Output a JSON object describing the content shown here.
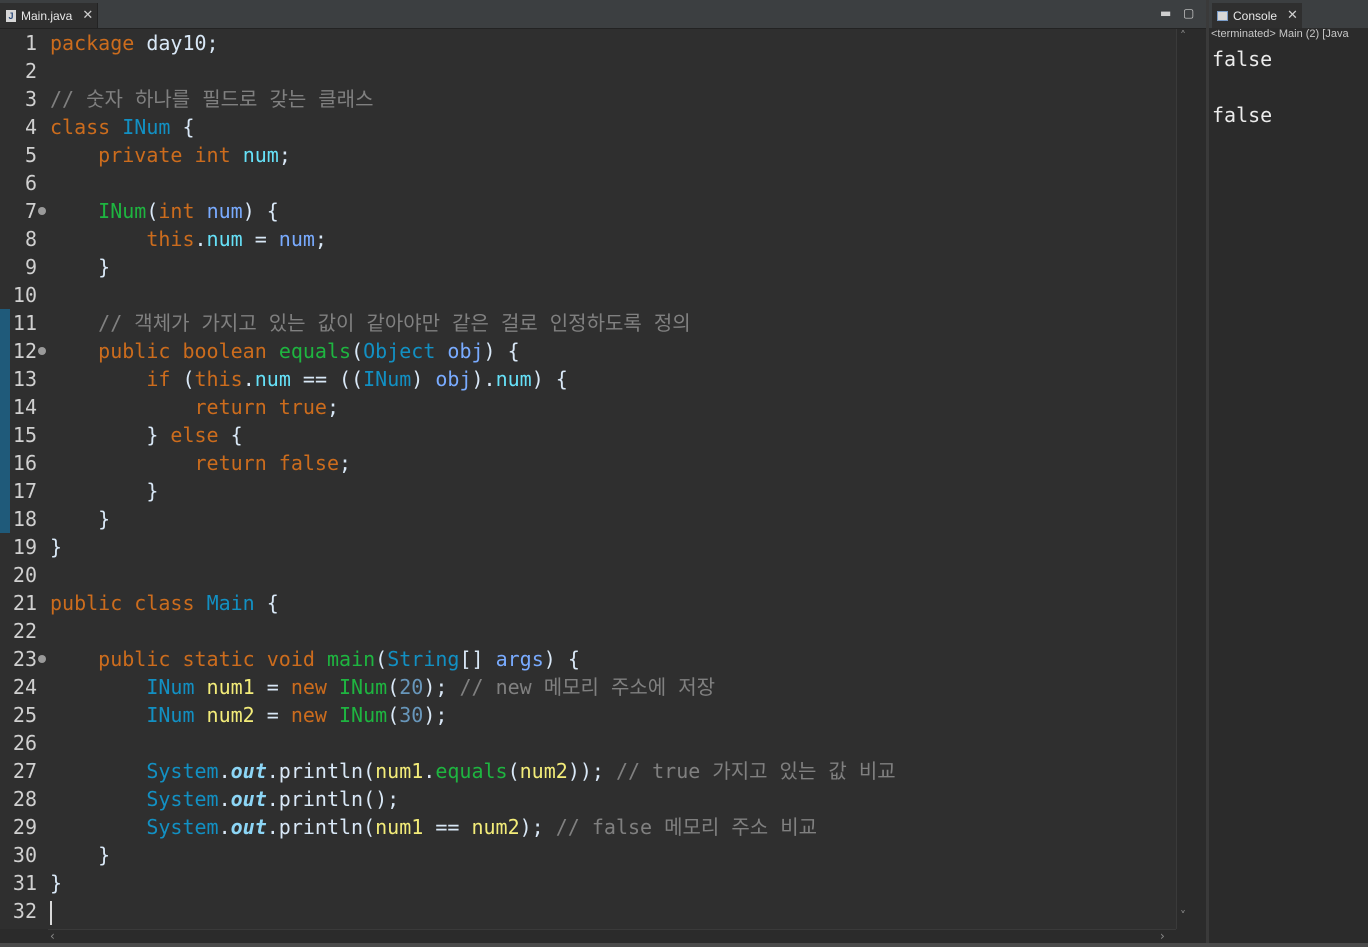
{
  "editor": {
    "tab_label": "Main.java",
    "file_icon_letter": "J",
    "line_numbers": [
      "1",
      "2",
      "3",
      "4",
      "5",
      "6",
      "7",
      "8",
      "9",
      "10",
      "11",
      "12",
      "13",
      "14",
      "15",
      "16",
      "17",
      "18",
      "19",
      "20",
      "21",
      "22",
      "23",
      "24",
      "25",
      "26",
      "27",
      "28",
      "29",
      "30",
      "31",
      "32"
    ],
    "code_lines": [
      [
        [
          "kw",
          "package"
        ],
        [
          "std",
          " day10;"
        ]
      ],
      [],
      [
        [
          "cmt",
          "// 숫자 하나를 필드로 갖는 클래스"
        ]
      ],
      [
        [
          "kw",
          "class"
        ],
        [
          "std",
          " "
        ],
        [
          "ty",
          "INum"
        ],
        [
          "std",
          " {"
        ]
      ],
      [
        [
          "std",
          "    "
        ],
        [
          "kw",
          "private"
        ],
        [
          "std",
          " "
        ],
        [
          "kw",
          "int"
        ],
        [
          "std",
          " "
        ],
        [
          "fld",
          "num"
        ],
        [
          "std",
          ";"
        ]
      ],
      [],
      [
        [
          "std",
          "    "
        ],
        [
          "mth",
          "INum"
        ],
        [
          "std",
          "("
        ],
        [
          "kw",
          "int"
        ],
        [
          "std",
          " "
        ],
        [
          "prm",
          "num"
        ],
        [
          "std",
          ") {"
        ]
      ],
      [
        [
          "std",
          "        "
        ],
        [
          "kw",
          "this"
        ],
        [
          "std",
          "."
        ],
        [
          "fld",
          "num"
        ],
        [
          "std",
          " = "
        ],
        [
          "prm",
          "num"
        ],
        [
          "std",
          ";"
        ]
      ],
      [
        [
          "std",
          "    }"
        ]
      ],
      [],
      [
        [
          "std",
          "    "
        ],
        [
          "cmt",
          "// 객체가 가지고 있는 값이 같아야만 같은 걸로 인정하도록 정의"
        ]
      ],
      [
        [
          "std",
          "    "
        ],
        [
          "kw",
          "public"
        ],
        [
          "std",
          " "
        ],
        [
          "kw",
          "boolean"
        ],
        [
          "std",
          " "
        ],
        [
          "mth",
          "equals"
        ],
        [
          "std",
          "("
        ],
        [
          "ty",
          "Object"
        ],
        [
          "std",
          " "
        ],
        [
          "prm",
          "obj"
        ],
        [
          "std",
          ") {"
        ]
      ],
      [
        [
          "std",
          "        "
        ],
        [
          "kw",
          "if"
        ],
        [
          "std",
          " ("
        ],
        [
          "kw",
          "this"
        ],
        [
          "std",
          "."
        ],
        [
          "fld",
          "num"
        ],
        [
          "std",
          " == (("
        ],
        [
          "ty",
          "INum"
        ],
        [
          "std",
          ") "
        ],
        [
          "prm",
          "obj"
        ],
        [
          "std",
          ")."
        ],
        [
          "fld",
          "num"
        ],
        [
          "std",
          ") {"
        ]
      ],
      [
        [
          "std",
          "            "
        ],
        [
          "kw",
          "return"
        ],
        [
          "std",
          " "
        ],
        [
          "kw",
          "true"
        ],
        [
          "std",
          ";"
        ]
      ],
      [
        [
          "std",
          "        } "
        ],
        [
          "kw",
          "else"
        ],
        [
          "std",
          " {"
        ]
      ],
      [
        [
          "std",
          "            "
        ],
        [
          "kw",
          "return"
        ],
        [
          "std",
          " "
        ],
        [
          "kw",
          "false"
        ],
        [
          "std",
          ";"
        ]
      ],
      [
        [
          "std",
          "        }"
        ]
      ],
      [
        [
          "std",
          "    }"
        ]
      ],
      [
        [
          "std",
          "}"
        ]
      ],
      [],
      [
        [
          "kw",
          "public"
        ],
        [
          "std",
          " "
        ],
        [
          "kw",
          "class"
        ],
        [
          "std",
          " "
        ],
        [
          "ty",
          "Main"
        ],
        [
          "std",
          " {"
        ]
      ],
      [],
      [
        [
          "std",
          "    "
        ],
        [
          "kw",
          "public"
        ],
        [
          "std",
          " "
        ],
        [
          "kw",
          "static"
        ],
        [
          "std",
          " "
        ],
        [
          "kw",
          "void"
        ],
        [
          "std",
          " "
        ],
        [
          "mth",
          "main"
        ],
        [
          "std",
          "("
        ],
        [
          "ty",
          "String"
        ],
        [
          "std",
          "[] "
        ],
        [
          "prm",
          "args"
        ],
        [
          "std",
          ") {"
        ]
      ],
      [
        [
          "std",
          "        "
        ],
        [
          "ty",
          "INum"
        ],
        [
          "std",
          " "
        ],
        [
          "var",
          "num1"
        ],
        [
          "std",
          " = "
        ],
        [
          "kw",
          "new"
        ],
        [
          "std",
          " "
        ],
        [
          "mth",
          "INum"
        ],
        [
          "std",
          "("
        ],
        [
          "num",
          "20"
        ],
        [
          "std",
          "); "
        ],
        [
          "cmt",
          "// new 메모리 주소에 저장"
        ]
      ],
      [
        [
          "std",
          "        "
        ],
        [
          "ty",
          "INum"
        ],
        [
          "std",
          " "
        ],
        [
          "var",
          "num2"
        ],
        [
          "std",
          " = "
        ],
        [
          "kw",
          "new"
        ],
        [
          "std",
          " "
        ],
        [
          "mth",
          "INum"
        ],
        [
          "std",
          "("
        ],
        [
          "num",
          "30"
        ],
        [
          "std",
          ");"
        ]
      ],
      [],
      [
        [
          "std",
          "        "
        ],
        [
          "ty",
          "System"
        ],
        [
          "std",
          "."
        ],
        [
          "stat",
          "out"
        ],
        [
          "std",
          ".println("
        ],
        [
          "var",
          "num1"
        ],
        [
          "std",
          "."
        ],
        [
          "mth",
          "equals"
        ],
        [
          "std",
          "("
        ],
        [
          "var",
          "num2"
        ],
        [
          "std",
          "));"
        ],
        [
          "std",
          " "
        ],
        [
          "cmt",
          "// true 가지고 있는 값 비교"
        ]
      ],
      [
        [
          "std",
          "        "
        ],
        [
          "ty",
          "System"
        ],
        [
          "std",
          "."
        ],
        [
          "stat",
          "out"
        ],
        [
          "std",
          ".println();"
        ]
      ],
      [
        [
          "std",
          "        "
        ],
        [
          "ty",
          "System"
        ],
        [
          "std",
          "."
        ],
        [
          "stat",
          "out"
        ],
        [
          "std",
          ".println("
        ],
        [
          "var",
          "num1"
        ],
        [
          "std",
          " == "
        ],
        [
          "var",
          "num2"
        ],
        [
          "std",
          "); "
        ],
        [
          "cmt",
          "// false 메모리 주소 비교"
        ]
      ],
      [
        [
          "std",
          "    }"
        ]
      ],
      [
        [
          "std",
          "}"
        ]
      ],
      []
    ]
  },
  "console": {
    "tab_label": "Console",
    "header": "<terminated> Main (2) [Java",
    "output": "false\n\nfalse"
  },
  "icons": [
    "java-file-icon",
    "close-icon",
    "minimize-icon",
    "maximize-icon",
    "console-icon",
    "fold-icon",
    "scroll-up-icon",
    "scroll-down-icon",
    "scroll-left-icon",
    "scroll-right-icon"
  ]
}
